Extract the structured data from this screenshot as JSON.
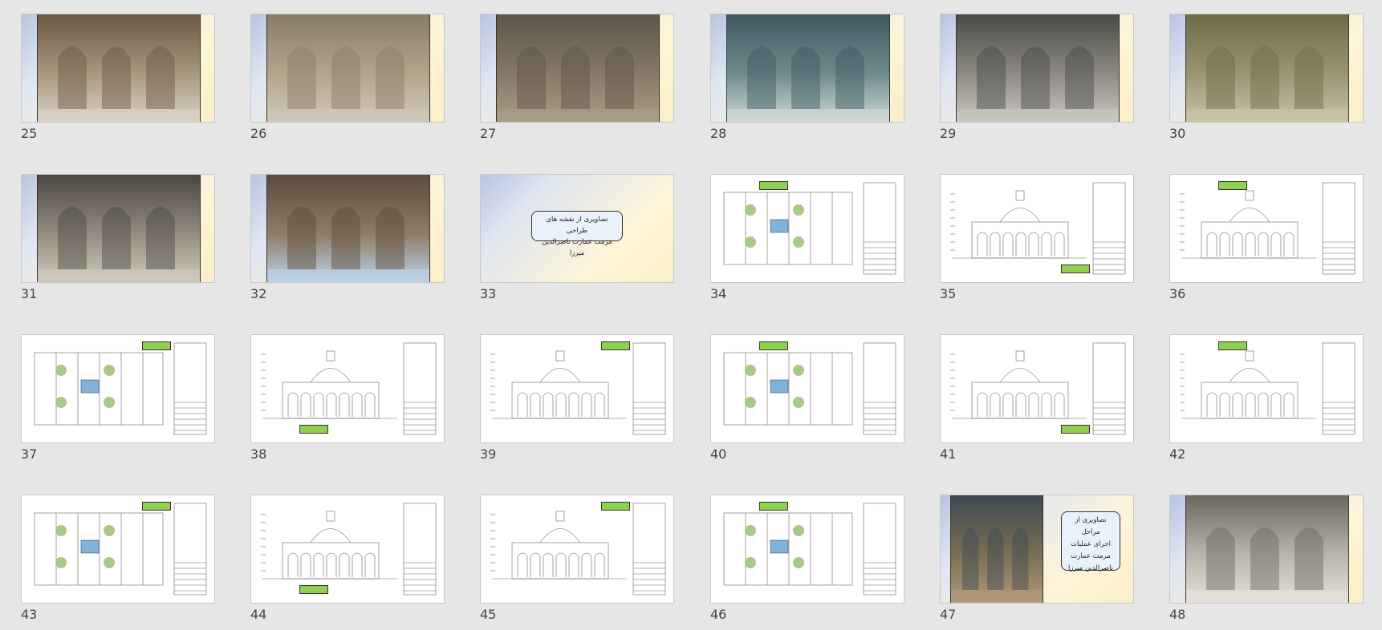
{
  "slides": [
    {
      "num": "25",
      "kind": "photo",
      "palette": [
        "#6b5744",
        "#a8987f",
        "#d9d2c4"
      ]
    },
    {
      "num": "26",
      "kind": "photo",
      "palette": [
        "#8a7b66",
        "#b3a58c",
        "#cfc8b8"
      ]
    },
    {
      "num": "27",
      "kind": "photo",
      "palette": [
        "#5e5547",
        "#857966",
        "#a99c86"
      ]
    },
    {
      "num": "28",
      "kind": "photo",
      "palette": [
        "#3f5860",
        "#6f8a8c",
        "#cfd8d6"
      ]
    },
    {
      "num": "29",
      "kind": "photo",
      "palette": [
        "#4a4a44",
        "#8c8a82",
        "#c8c6bf"
      ]
    },
    {
      "num": "30",
      "kind": "photo",
      "palette": [
        "#6d6a45",
        "#9a9473",
        "#c9c3a8"
      ]
    },
    {
      "num": "31",
      "kind": "photo",
      "palette": [
        "#4b4640",
        "#948c80",
        "#cfc8bc"
      ]
    },
    {
      "num": "32",
      "kind": "photo",
      "palette": [
        "#5c4b3c",
        "#8f7b66",
        "#bcd2e8"
      ]
    },
    {
      "num": "33",
      "kind": "title",
      "title_lines": [
        "تصاویری از نقشه های طراحی",
        "مرمت عمارت ناصرالدین میرزا"
      ]
    },
    {
      "num": "34",
      "kind": "drawing"
    },
    {
      "num": "35",
      "kind": "drawing"
    },
    {
      "num": "36",
      "kind": "drawing"
    },
    {
      "num": "37",
      "kind": "drawing"
    },
    {
      "num": "38",
      "kind": "drawing"
    },
    {
      "num": "39",
      "kind": "drawing"
    },
    {
      "num": "40",
      "kind": "drawing"
    },
    {
      "num": "41",
      "kind": "drawing"
    },
    {
      "num": "42",
      "kind": "drawing"
    },
    {
      "num": "43",
      "kind": "drawing"
    },
    {
      "num": "44",
      "kind": "drawing"
    },
    {
      "num": "45",
      "kind": "drawing"
    },
    {
      "num": "46",
      "kind": "drawing"
    },
    {
      "num": "47",
      "kind": "photo-title",
      "palette": [
        "#3d4a52",
        "#7b6d55",
        "#b09a78"
      ],
      "title_lines": [
        "تصاویری از مراحل",
        "اجرای عملیات",
        "مرمت عمارت",
        "ناصرالدین میرزا"
      ]
    },
    {
      "num": "48",
      "kind": "photo",
      "palette": [
        "#6a6660",
        "#b9b4ab",
        "#e4e0d8"
      ]
    }
  ]
}
